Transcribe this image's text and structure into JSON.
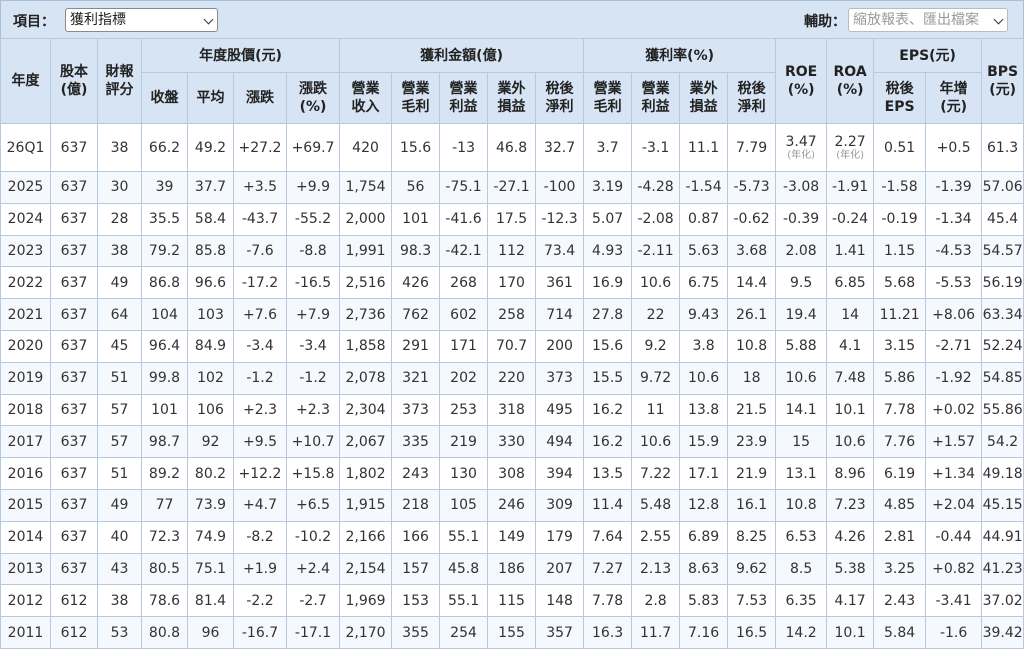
{
  "toolbar": {
    "item_label": "項目：",
    "metric_value": "獲利指標",
    "aux_label": "輔助：",
    "aux_placeholder": "縮放報表、匯出檔案"
  },
  "header": {
    "year": "年度",
    "capital": [
      "股本",
      "(億)"
    ],
    "rating": [
      "財報",
      "評分"
    ],
    "price_group": "年度股價(元)",
    "price_cols": [
      "收盤",
      "平均",
      "漲跌",
      [
        "漲跌",
        "(%)"
      ]
    ],
    "profit_group": "獲利金額(億)",
    "profit_cols": [
      [
        "營業",
        "收入"
      ],
      [
        "營業",
        "毛利"
      ],
      [
        "營業",
        "利益"
      ],
      [
        "業外",
        "損益"
      ],
      [
        "稅後",
        "淨利"
      ]
    ],
    "margin_group": "獲利率(%)",
    "margin_cols": [
      [
        "營業",
        "毛利"
      ],
      [
        "營業",
        "利益"
      ],
      [
        "業外",
        "損益"
      ],
      [
        "稅後",
        "淨利"
      ]
    ],
    "roe": [
      "ROE",
      "(%)"
    ],
    "roa": [
      "ROA",
      "(%)"
    ],
    "eps_group": "EPS(元)",
    "eps_cols": [
      [
        "稅後",
        "EPS"
      ],
      [
        "年增",
        "(元)"
      ]
    ],
    "bps": [
      "BPS",
      "(元)"
    ]
  },
  "annualized_note": "(年化)",
  "rows": [
    [
      "26Q1",
      "637",
      "38",
      "66.2",
      "49.2",
      "+27.2",
      "+69.7",
      "420",
      "15.6",
      "-13",
      "46.8",
      "32.7",
      "3.7",
      "-3.1",
      "11.1",
      "7.79",
      "3.47",
      "2.27",
      "0.51",
      "+0.5",
      "61.3"
    ],
    [
      "2025",
      "637",
      "30",
      "39",
      "37.7",
      "+3.5",
      "+9.9",
      "1,754",
      "56",
      "-75.1",
      "-27.1",
      "-100",
      "3.19",
      "-4.28",
      "-1.54",
      "-5.73",
      "-3.08",
      "-1.91",
      "-1.58",
      "-1.39",
      "57.06"
    ],
    [
      "2024",
      "637",
      "28",
      "35.5",
      "58.4",
      "-43.7",
      "-55.2",
      "2,000",
      "101",
      "-41.6",
      "17.5",
      "-12.3",
      "5.07",
      "-2.08",
      "0.87",
      "-0.62",
      "-0.39",
      "-0.24",
      "-0.19",
      "-1.34",
      "45.4"
    ],
    [
      "2023",
      "637",
      "38",
      "79.2",
      "85.8",
      "-7.6",
      "-8.8",
      "1,991",
      "98.3",
      "-42.1",
      "112",
      "73.4",
      "4.93",
      "-2.11",
      "5.63",
      "3.68",
      "2.08",
      "1.41",
      "1.15",
      "-4.53",
      "54.57"
    ],
    [
      "2022",
      "637",
      "49",
      "86.8",
      "96.6",
      "-17.2",
      "-16.5",
      "2,516",
      "426",
      "268",
      "170",
      "361",
      "16.9",
      "10.6",
      "6.75",
      "14.4",
      "9.5",
      "6.85",
      "5.68",
      "-5.53",
      "56.19"
    ],
    [
      "2021",
      "637",
      "64",
      "104",
      "103",
      "+7.6",
      "+7.9",
      "2,736",
      "762",
      "602",
      "258",
      "714",
      "27.8",
      "22",
      "9.43",
      "26.1",
      "19.4",
      "14",
      "11.21",
      "+8.06",
      "63.34"
    ],
    [
      "2020",
      "637",
      "45",
      "96.4",
      "84.9",
      "-3.4",
      "-3.4",
      "1,858",
      "291",
      "171",
      "70.7",
      "200",
      "15.6",
      "9.2",
      "3.8",
      "10.8",
      "5.88",
      "4.1",
      "3.15",
      "-2.71",
      "52.24"
    ],
    [
      "2019",
      "637",
      "51",
      "99.8",
      "102",
      "-1.2",
      "-1.2",
      "2,078",
      "321",
      "202",
      "220",
      "373",
      "15.5",
      "9.72",
      "10.6",
      "18",
      "10.6",
      "7.48",
      "5.86",
      "-1.92",
      "54.85"
    ],
    [
      "2018",
      "637",
      "57",
      "101",
      "106",
      "+2.3",
      "+2.3",
      "2,304",
      "373",
      "253",
      "318",
      "495",
      "16.2",
      "11",
      "13.8",
      "21.5",
      "14.1",
      "10.1",
      "7.78",
      "+0.02",
      "55.86"
    ],
    [
      "2017",
      "637",
      "57",
      "98.7",
      "92",
      "+9.5",
      "+10.7",
      "2,067",
      "335",
      "219",
      "330",
      "494",
      "16.2",
      "10.6",
      "15.9",
      "23.9",
      "15",
      "10.6",
      "7.76",
      "+1.57",
      "54.2"
    ],
    [
      "2016",
      "637",
      "51",
      "89.2",
      "80.2",
      "+12.2",
      "+15.8",
      "1,802",
      "243",
      "130",
      "308",
      "394",
      "13.5",
      "7.22",
      "17.1",
      "21.9",
      "13.1",
      "8.96",
      "6.19",
      "+1.34",
      "49.18"
    ],
    [
      "2015",
      "637",
      "49",
      "77",
      "73.9",
      "+4.7",
      "+6.5",
      "1,915",
      "218",
      "105",
      "246",
      "309",
      "11.4",
      "5.48",
      "12.8",
      "16.1",
      "10.8",
      "7.23",
      "4.85",
      "+2.04",
      "45.15"
    ],
    [
      "2014",
      "637",
      "40",
      "72.3",
      "74.9",
      "-8.2",
      "-10.2",
      "2,166",
      "166",
      "55.1",
      "149",
      "179",
      "7.64",
      "2.55",
      "6.89",
      "8.25",
      "6.53",
      "4.26",
      "2.81",
      "-0.44",
      "44.91"
    ],
    [
      "2013",
      "637",
      "43",
      "80.5",
      "75.1",
      "+1.9",
      "+2.4",
      "2,154",
      "157",
      "45.8",
      "186",
      "207",
      "7.27",
      "2.13",
      "8.63",
      "9.62",
      "8.5",
      "5.38",
      "3.25",
      "+0.82",
      "41.23"
    ],
    [
      "2012",
      "612",
      "38",
      "78.6",
      "81.4",
      "-2.2",
      "-2.7",
      "1,969",
      "153",
      "55.1",
      "115",
      "148",
      "7.78",
      "2.8",
      "5.83",
      "7.53",
      "6.35",
      "4.17",
      "2.43",
      "-3.41",
      "37.02"
    ],
    [
      "2011",
      "612",
      "53",
      "80.8",
      "96",
      "-16.7",
      "-17.1",
      "2,170",
      "355",
      "254",
      "155",
      "357",
      "16.3",
      "11.7",
      "7.16",
      "16.5",
      "14.2",
      "10.1",
      "5.84",
      "-1.6",
      "39.42"
    ]
  ],
  "colors": {
    "positive": "#e8171a",
    "negative": "#1a9a1a",
    "rating_low": "#2f9a2f",
    "header_bg": "#d6e4f4"
  }
}
